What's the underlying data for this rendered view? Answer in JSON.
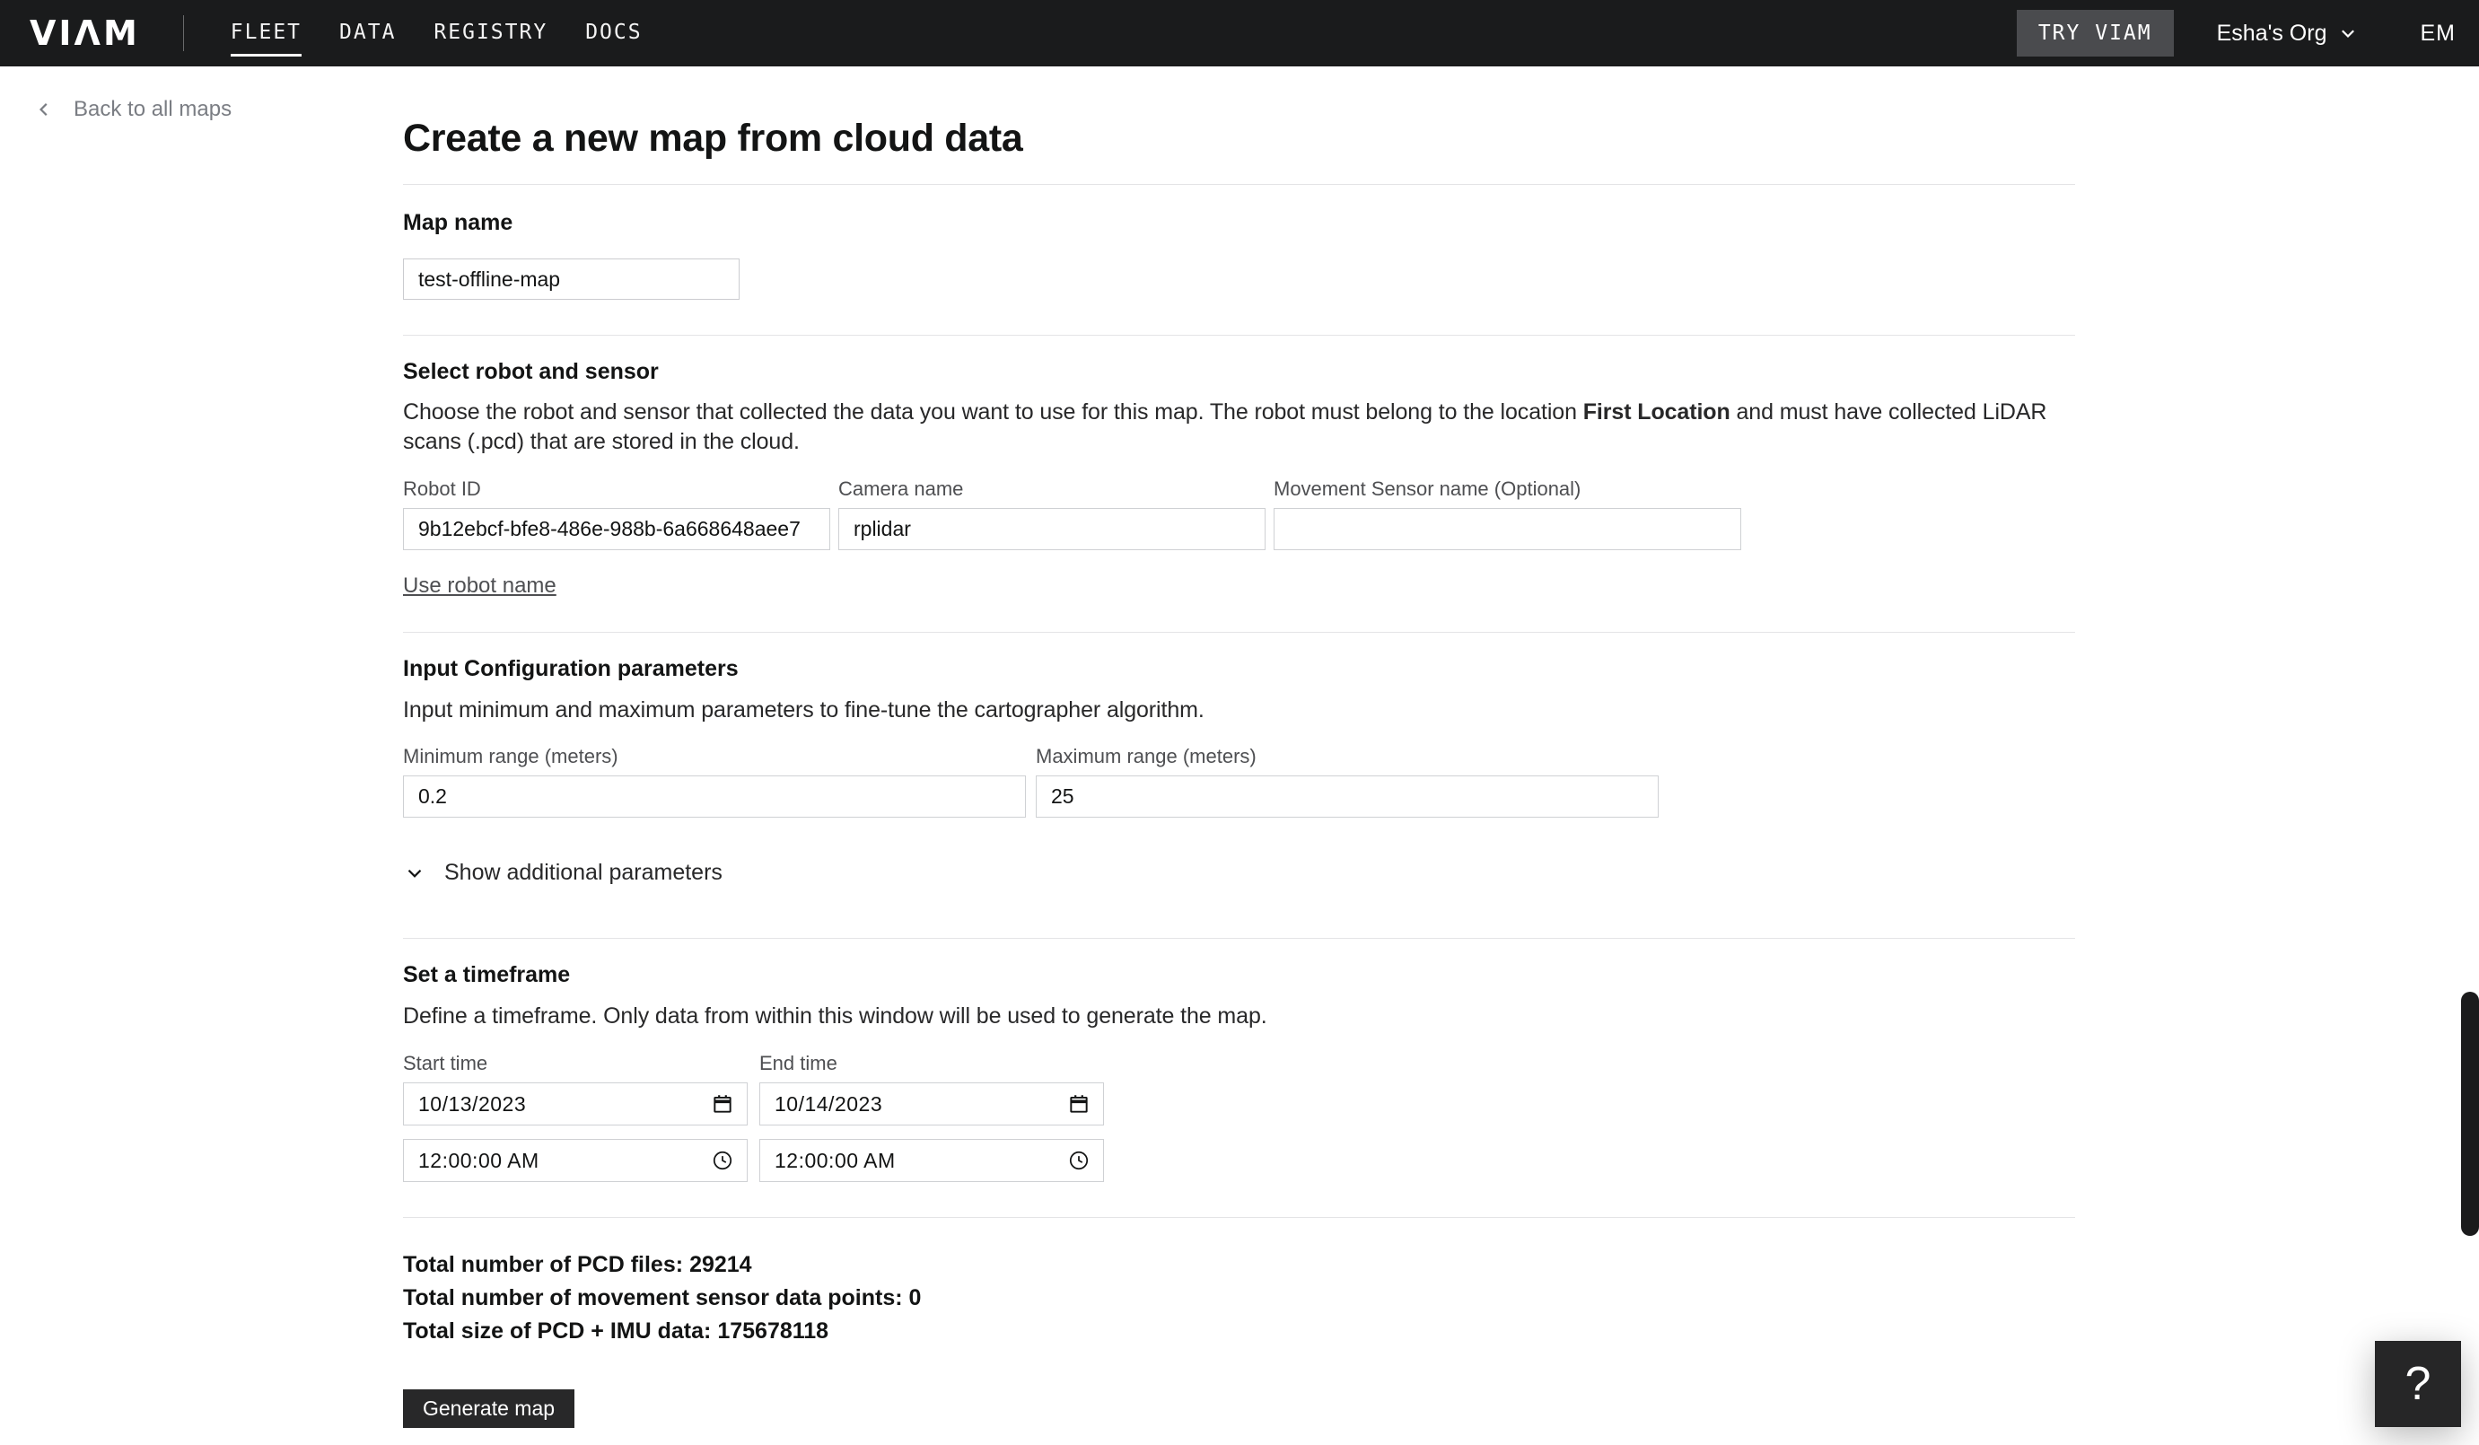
{
  "nav": {
    "logo": "VIΛM",
    "links": [
      {
        "label": "FLEET",
        "active": true
      },
      {
        "label": "DATA",
        "active": false
      },
      {
        "label": "REGISTRY",
        "active": false
      },
      {
        "label": "DOCS",
        "active": false
      }
    ],
    "try_viam_label": "TRY VIAM",
    "org_name": "Esha's Org",
    "avatar_initials": "EM"
  },
  "back_link_label": "Back to all maps",
  "page": {
    "title": "Create a new map from cloud data"
  },
  "map_name": {
    "heading": "Map name",
    "value": "test-offline-map"
  },
  "robot_section": {
    "heading": "Select robot and sensor",
    "description_prefix": "Choose the robot and sensor that collected the data you want to use for this map. The robot must belong to the location ",
    "location_name": "First Location",
    "description_suffix": " and must have collected LiDAR scans (.pcd) that are stored in the cloud.",
    "robot_id": {
      "label": "Robot ID",
      "value": "9b12ebcf-bfe8-486e-988b-6a668648aee7"
    },
    "camera": {
      "label": "Camera name",
      "value": "rplidar"
    },
    "movement_sensor": {
      "label": "Movement Sensor name (Optional)",
      "value": ""
    },
    "use_robot_name_label": "Use robot name"
  },
  "config_section": {
    "heading": "Input Configuration parameters",
    "description": "Input minimum and maximum parameters to fine-tune the cartographer algorithm.",
    "min_range": {
      "label": "Minimum range (meters)",
      "value": "0.2"
    },
    "max_range": {
      "label": "Maximum range (meters)",
      "value": "25"
    },
    "show_additional_label": "Show additional parameters"
  },
  "timeframe_section": {
    "heading": "Set a timeframe",
    "description": "Define a timeframe. Only data from within this window will be used to generate the map.",
    "start": {
      "label": "Start time",
      "date": "10/13/2023",
      "time": "12:00:00 AM"
    },
    "end": {
      "label": "End time",
      "date": "10/14/2023",
      "time": "12:00:00 AM"
    }
  },
  "summary": {
    "items": [
      {
        "label": "Total number of PCD files:",
        "value": "29214"
      },
      {
        "label": "Total number of movement sensor data points:",
        "value": "0"
      },
      {
        "label": "Total size of PCD + IMU data:",
        "value": "175678118"
      }
    ]
  },
  "generate_button_label": "Generate map",
  "help_button_label": "?",
  "icons": {
    "back": "chevron-left",
    "org_dropdown": "chevron-down",
    "show_additional": "chevron-down",
    "date_picker": "calendar",
    "time_picker": "clock"
  },
  "colors": {
    "nav_background": "#1a1b1c",
    "try_viam_background": "#4a4b4e",
    "primary_button_background": "#282829",
    "heading_text": "#131414",
    "body_text": "#282829",
    "label_text": "#4e4f52",
    "input_border": "#cfd1d4",
    "divider": "#e4e4e6"
  }
}
